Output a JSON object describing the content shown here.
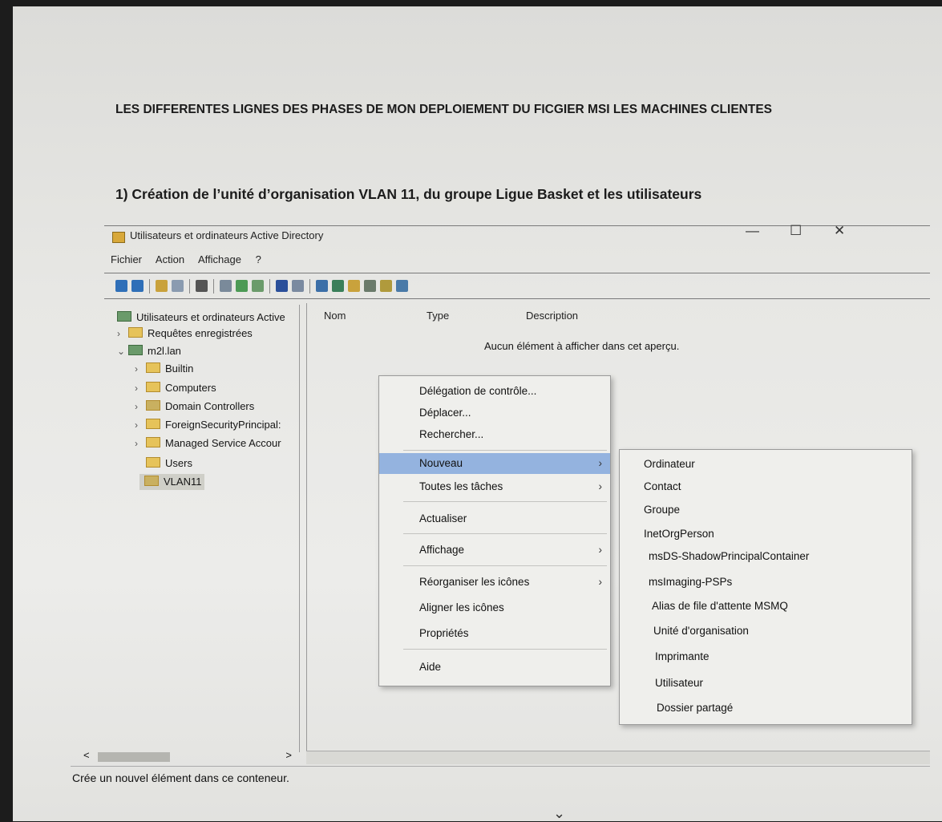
{
  "document": {
    "title": "LES DIFFERENTES LIGNES DES PHASES DE MON DEPLOIEMENT DU FICGIER MSI   LES MACHINES CLIENTES",
    "section": "1)  Création de l’unité d’organisation VLAN 11, du groupe Ligue Basket et les utilisateurs"
  },
  "window": {
    "title": "Utilisateurs et ordinateurs Active Directory",
    "minimize": "—",
    "maximize": "☐",
    "close": "✕"
  },
  "menubar": [
    "Fichier",
    "Action",
    "Affichage",
    "?"
  ],
  "tree": {
    "root": "Utilisateurs et ordinateurs Active",
    "saved_queries": "Requêtes enregistrées",
    "domain": "m2l.lan",
    "children": [
      "Builtin",
      "Computers",
      "Domain Controllers",
      "ForeignSecurityPrincipal:",
      "Managed Service Accour",
      "Users",
      "VLAN11"
    ]
  },
  "list": {
    "columns": [
      "Nom",
      "Type",
      "Description"
    ],
    "empty_message": "Aucun élément à afficher dans cet aperçu."
  },
  "context_menu": {
    "items": [
      "Délégation de contrôle...",
      "Déplacer...",
      "Rechercher...",
      "Nouveau",
      "Toutes les tâches",
      "Actualiser",
      "Affichage",
      "Réorganiser les icônes",
      "Aligner les icônes",
      "Propriétés",
      "Aide"
    ],
    "submenu_arrow": "›"
  },
  "submenu": {
    "items": [
      "Ordinateur",
      "Contact",
      "Groupe",
      "InetOrgPerson",
      "msDS-ShadowPrincipalContainer",
      "msImaging-PSPs",
      "Alias de file d'attente MSMQ",
      "Unité d'organisation",
      "Imprimante",
      "Utilisateur",
      "Dossier partagé"
    ]
  },
  "scroll": {
    "left": "<",
    "right": ">"
  },
  "status": "Crée un nouvel élément dans ce conteneur.",
  "bottom_glyph": "⌄",
  "colors": {
    "highlight": "#94b3df",
    "menu_bg": "#efefec",
    "folder": "#e6c35a"
  }
}
